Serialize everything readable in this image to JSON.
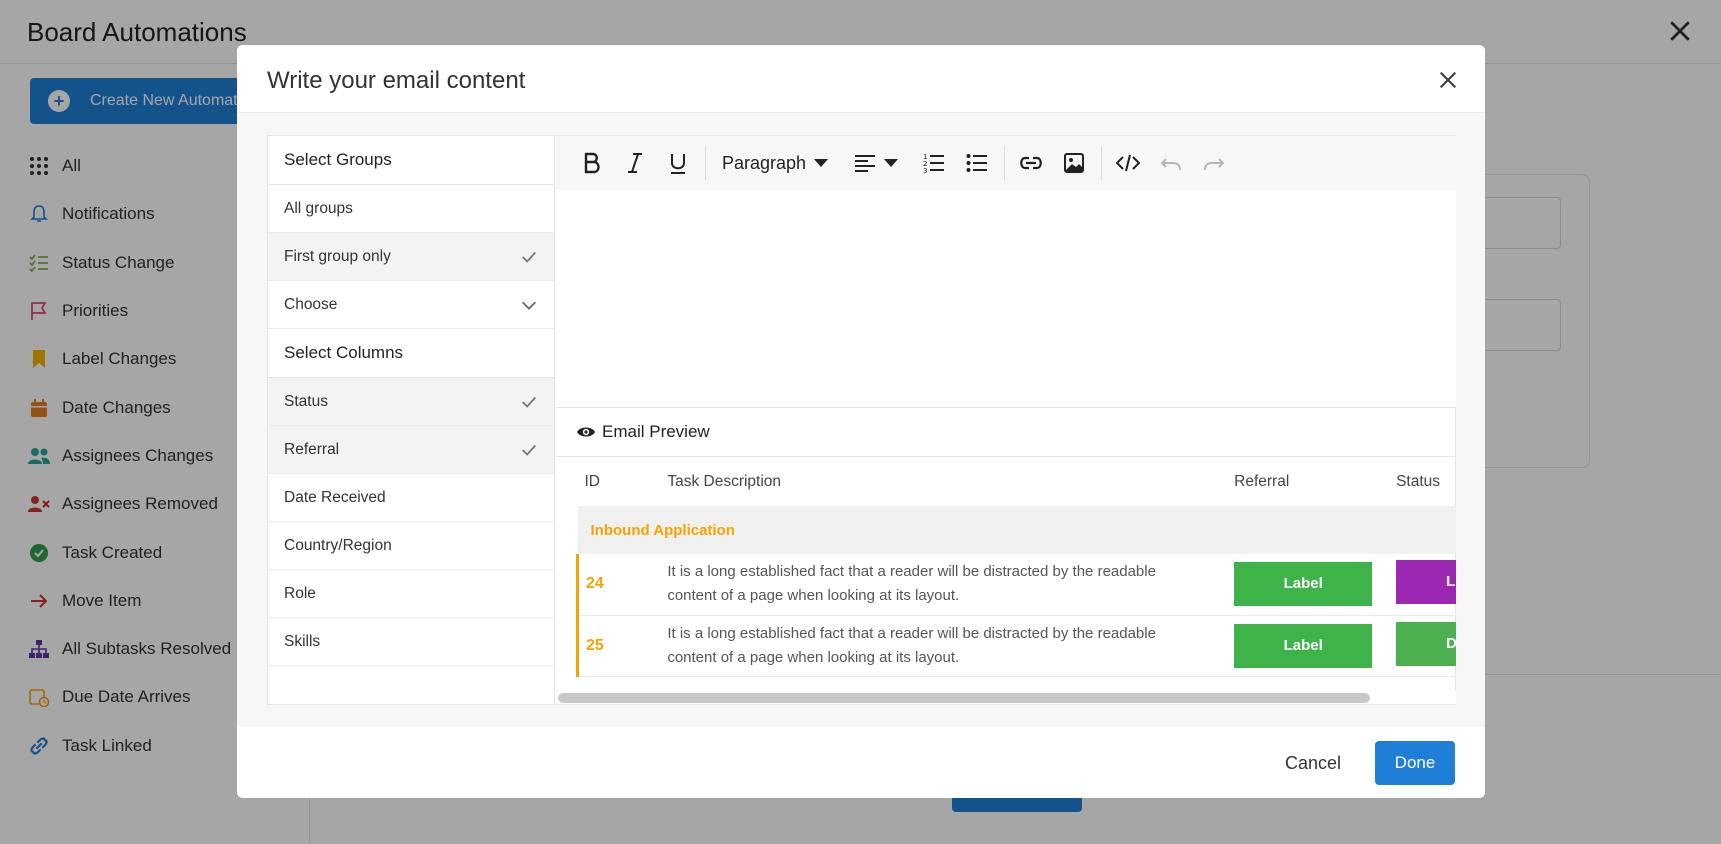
{
  "app": {
    "title": "Board Automations",
    "create_button": "Create New Automation",
    "sidebar": [
      {
        "label": "All",
        "icon": "grid-icon",
        "color": "#333333"
      },
      {
        "label": "Notifications",
        "icon": "bell-icon",
        "color": "#1f7fd6"
      },
      {
        "label": "Status Change",
        "icon": "checklist-icon",
        "color": "#7cb342"
      },
      {
        "label": "Priorities",
        "icon": "flag-icon",
        "color": "#e0417a"
      },
      {
        "label": "Label Changes",
        "icon": "bookmark-icon",
        "color": "#f5b400"
      },
      {
        "label": "Date Changes",
        "icon": "calendar-icon",
        "color": "#e67e22"
      },
      {
        "label": "Assignees Changes",
        "icon": "users-icon",
        "color": "#26a69a"
      },
      {
        "label": "Assignees Removed",
        "icon": "user-remove-icon",
        "color": "#d32f2f"
      },
      {
        "label": "Task Created",
        "icon": "check-circle-icon",
        "color": "#2e9e4a"
      },
      {
        "label": "Move Item",
        "icon": "arrow-right-icon",
        "color": "#d32f2f"
      },
      {
        "label": "All Subtasks Resolved",
        "icon": "hierarchy-icon",
        "color": "#5e35b1"
      },
      {
        "label": "Due Date Arrives",
        "icon": "calendar-clock-icon",
        "color": "#f5a300"
      },
      {
        "label": "Task Linked",
        "icon": "link-icon",
        "color": "#1f7fd6"
      }
    ]
  },
  "modal": {
    "title": "Write your email content",
    "groups_heading": "Select Groups",
    "group_options": [
      {
        "label": "All groups",
        "selected": false
      },
      {
        "label": "First group only",
        "selected": true
      }
    ],
    "choose_label": "Choose",
    "columns_heading": "Select Columns",
    "column_options": [
      {
        "label": "Status",
        "selected": true
      },
      {
        "label": "Referral",
        "selected": true
      },
      {
        "label": "Date Received",
        "selected": false
      },
      {
        "label": "Country/Region",
        "selected": false
      },
      {
        "label": "Role",
        "selected": false
      },
      {
        "label": "Skills",
        "selected": false
      }
    ],
    "toolbar": {
      "paragraph_label": "Paragraph",
      "buttons": [
        "bold-icon",
        "italic-icon",
        "underline-icon",
        "align-left-icon",
        "ordered-list-icon",
        "bullet-list-icon",
        "link-icon",
        "image-icon",
        "code-icon",
        "undo-icon",
        "redo-icon"
      ]
    },
    "preview": {
      "heading": "Email Preview",
      "columns": [
        "ID",
        "Task Description",
        "Referral",
        "Status"
      ],
      "group_name": "Inbound Application",
      "group_color": "#f5a300",
      "rows": [
        {
          "id": "24",
          "description": "It is a long established fact that a reader will be distracted by the readable content of a page when looking at its layout.",
          "referral": "Label",
          "referral_color": "#3db34a",
          "status": "L",
          "status_color": "#9c27b0"
        },
        {
          "id": "25",
          "description": "It is a long established fact that a reader will be distracted by the readable content of a page when looking at its layout.",
          "referral": "Label",
          "referral_color": "#3db34a",
          "status": "D",
          "status_color": "#4caf50"
        }
      ]
    },
    "cancel_label": "Cancel",
    "done_label": "Done",
    "accent_color": "#1f7fd6"
  }
}
